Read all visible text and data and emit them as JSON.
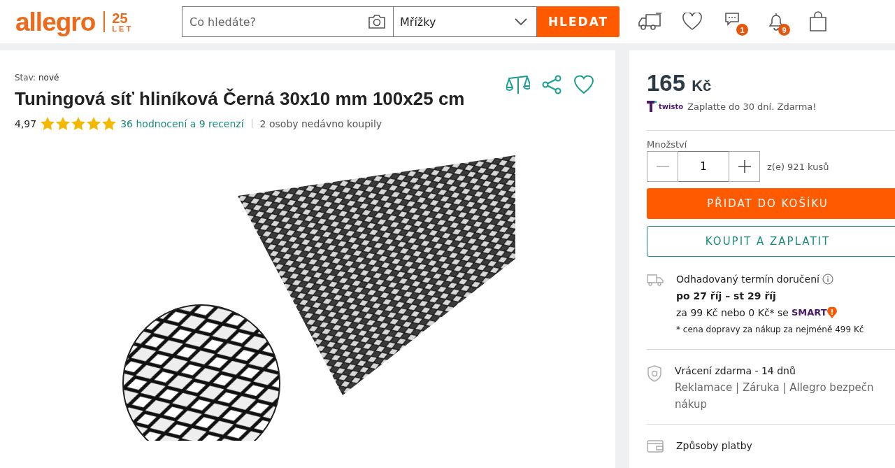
{
  "header": {
    "logo": "allegro",
    "anniversary": {
      "number": "25",
      "word": "LET"
    },
    "search": {
      "placeholder": "Co hledáte?"
    },
    "category": {
      "value": "Mřížky"
    },
    "search_button": "HLEDAT",
    "icons": [
      {
        "kind": "truck"
      },
      {
        "kind": "heart"
      },
      {
        "kind": "chat",
        "badge": "1"
      },
      {
        "kind": "bell",
        "badge": "9"
      },
      {
        "kind": "bag"
      }
    ]
  },
  "product": {
    "condition_label": "Stav:",
    "condition": "nové",
    "title": "Tuningová síť hliníková Černá 30x10 mm 100x25 cm",
    "actions": [
      {
        "kind": "compare"
      },
      {
        "kind": "share"
      },
      {
        "kind": "heart"
      }
    ],
    "rating": {
      "score": "4,97",
      "stars": 5,
      "reviews_link": "36 hodnocení a 9 recenzí",
      "recent": "2 osoby nedávno koupily"
    }
  },
  "offer": {
    "price": "165",
    "currency": "Kč",
    "twisto": {
      "brand": "twisto",
      "text": "Zaplatte do 30 dní. Zdarma!"
    },
    "quantity": {
      "label": "Množství",
      "value": "1",
      "stock": "z(e) 921 kusů"
    },
    "add_to_cart": "PŘIDAT DO KOŠÍKU",
    "buy_now": "KOUPIT A ZAPLATIT",
    "delivery": {
      "title": "Odhadovaný termín doručení",
      "dates": "po 27 říj – st 29 říj",
      "price_text": "za 99 Kč nebo 0 Kč* se",
      "smart": "SMART",
      "note": "* cena dopravy za nákup za nejméně 499 Kč"
    },
    "returns": {
      "title": "Vrácení zdarma - 14 dnů",
      "lines": [
        "Reklamace | Záruka | Allegro bezpečn",
        "nákup"
      ]
    },
    "payment": {
      "title": "Způsoby platby"
    }
  }
}
